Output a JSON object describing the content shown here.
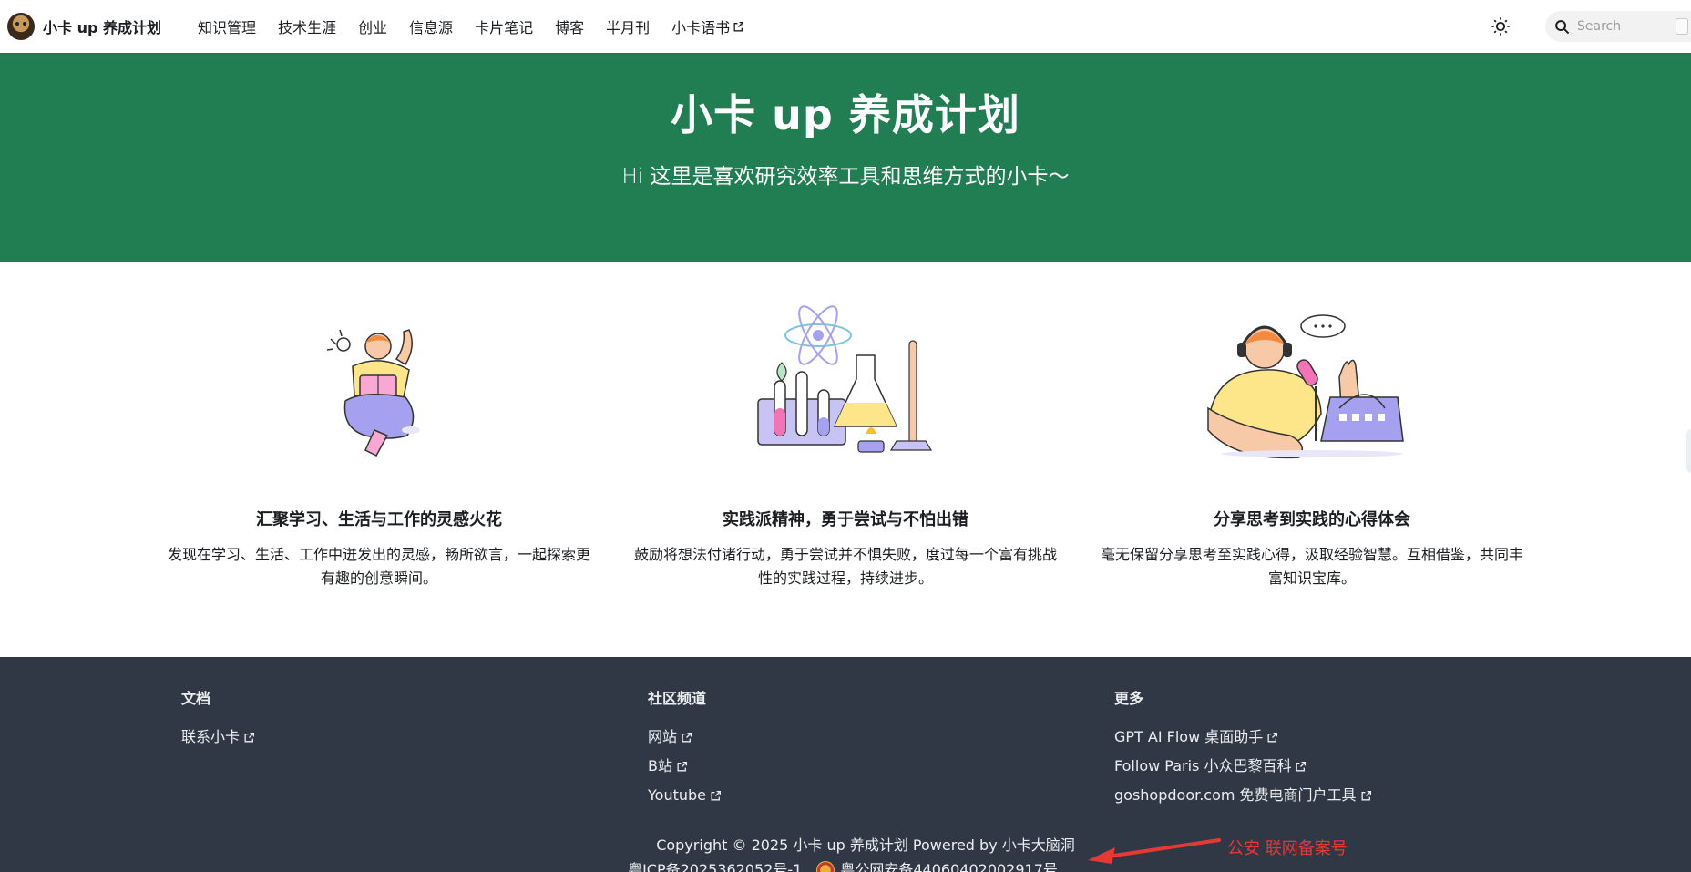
{
  "nav": {
    "brand_title": "小卡 up 养成计划",
    "links": [
      "知识管理",
      "技术生涯",
      "创业",
      "信息源",
      "卡片笔记",
      "博客",
      "半月刊",
      "小卡语书"
    ],
    "search_placeholder": "Search"
  },
  "hero": {
    "title": "小卡 up 养成计划",
    "subtitle": "Hi 这里是喜欢研究效率工具和思维方式的小卡～"
  },
  "features": [
    {
      "title": "汇聚学习、生活与工作的灵感火花",
      "desc": "发现在学习、生活、工作中迸发出的灵感，畅所欲言，一起探索更有趣的创意瞬间。"
    },
    {
      "title": "实践派精神，勇于尝试与不怕出错",
      "desc": "鼓励将想法付诸行动，勇于尝试并不惧失败，度过每一个富有挑战性的实践过程，持续进步。"
    },
    {
      "title": "分享思考到实践的心得体会",
      "desc": "毫无保留分享思考至实践心得，汲取经验智慧。互相借鉴，共同丰富知识宝库。"
    }
  ],
  "footer": {
    "columns": [
      {
        "title": "文档",
        "links": [
          "联系小卡"
        ]
      },
      {
        "title": "社区频道",
        "links": [
          "网站",
          "B站",
          "Youtube"
        ]
      },
      {
        "title": "更多",
        "links": [
          "GPT AI Flow 桌面助手",
          "Follow Paris 小众巴黎百科",
          "goshopdoor.com 免费电商门户工具"
        ]
      }
    ],
    "copyright": "Copyright © 2025 小卡 up 养成计划 Powered by 小卡大脑洞",
    "icp": "粤ICP备2025362052号-1",
    "police": "粤公网安备44060402002917号"
  },
  "annotation": {
    "text": "公安 联网备案号",
    "color": "#e53935"
  },
  "colors": {
    "hero_bg": "#217d52",
    "footer_bg": "#303846"
  },
  "icons": {
    "theme_toggle": "sun-icon",
    "search": "search-icon",
    "external": "external-link-icon"
  }
}
